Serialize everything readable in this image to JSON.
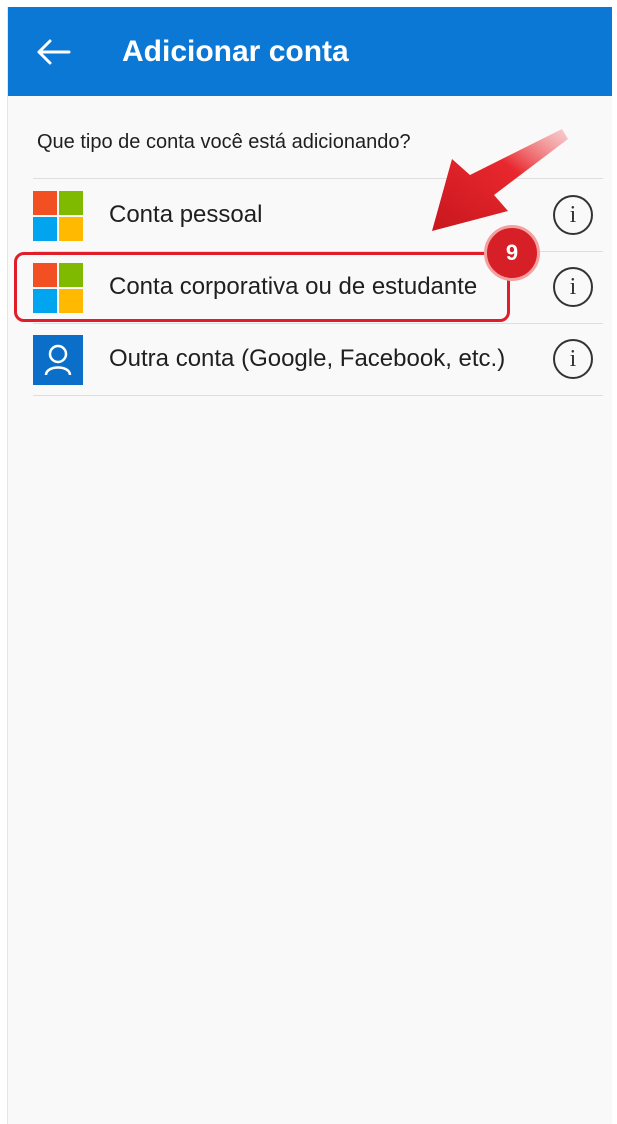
{
  "appbar": {
    "title": "Adicionar conta",
    "back_icon": "arrow-left-icon",
    "color": "#0a78d4"
  },
  "question": "Que tipo de conta você está adicionando?",
  "accounts": [
    {
      "label": "Conta pessoal",
      "icon": "microsoft-logo-icon"
    },
    {
      "label": "Conta corporativa ou de estudante",
      "icon": "microsoft-logo-icon"
    },
    {
      "label": "Outra conta (Google, Facebook, etc.)",
      "icon": "person-icon"
    }
  ],
  "info_glyph": "i",
  "annotation": {
    "step_number": "9",
    "color": "#e11d2a"
  },
  "ms_logo_colors": [
    "#f25022",
    "#7fba00",
    "#00a4ef",
    "#ffb900"
  ]
}
